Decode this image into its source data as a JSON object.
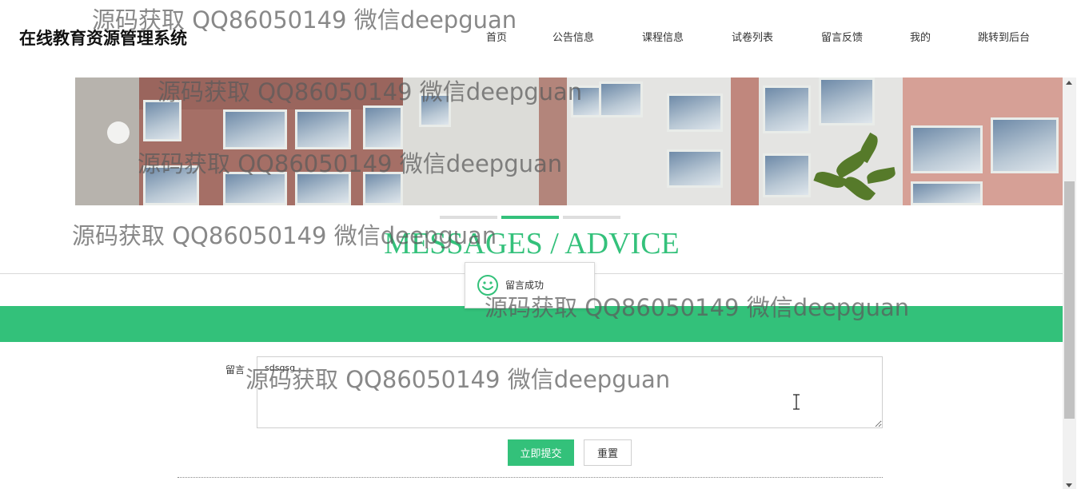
{
  "header": {
    "logo": "在线教育资源管理系统",
    "nav": [
      {
        "label": "首页",
        "name": "nav-home"
      },
      {
        "label": "公告信息",
        "name": "nav-announcements"
      },
      {
        "label": "课程信息",
        "name": "nav-courses"
      },
      {
        "label": "试卷列表",
        "name": "nav-papers"
      },
      {
        "label": "留言反馈",
        "name": "nav-feedback"
      },
      {
        "label": "我的",
        "name": "nav-mine"
      },
      {
        "label": "跳转到后台",
        "name": "nav-admin"
      }
    ]
  },
  "banner": {
    "indicators": [
      {
        "active": false
      },
      {
        "active": true
      },
      {
        "active": false
      }
    ]
  },
  "section": {
    "title": "MESSAGES / ADVICE"
  },
  "toast": {
    "icon": "smile-icon",
    "text": "留言成功"
  },
  "form": {
    "label": "留言",
    "value": "sdsgsg",
    "submit_label": "立即提交",
    "reset_label": "重置"
  },
  "watermark": {
    "text": "源码获取 QQ86050149 微信deepguan"
  },
  "colors": {
    "accent": "#33c17a",
    "title": "#34c17b"
  }
}
